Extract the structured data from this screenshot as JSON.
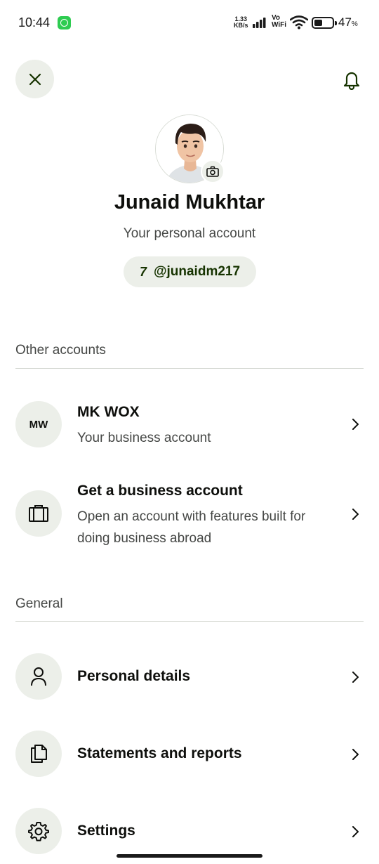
{
  "status_bar": {
    "time": "10:44",
    "net_speed_value": "1.33",
    "net_speed_unit": "KB/s",
    "vo_label": "Vo",
    "wifi_label": "WiFi",
    "battery_percent": "47",
    "battery_level": 0.47,
    "percent_sign": "%"
  },
  "header": {
    "close_icon": "close-icon",
    "notification_icon": "bell-icon"
  },
  "profile": {
    "name": "Junaid Mukhtar",
    "account_type": "Your personal account",
    "brand_mark": "7",
    "handle": "@junaidm217",
    "camera_icon": "camera-icon"
  },
  "other_accounts": {
    "title": "Other accounts",
    "items": [
      {
        "initials": "MW",
        "name": "MK WOX",
        "description": "Your business account"
      },
      {
        "icon": "briefcase-icon",
        "name": "Get a business account",
        "description": "Open an account with features built for doing business abroad"
      }
    ]
  },
  "general": {
    "title": "General",
    "items": [
      {
        "icon": "person-icon",
        "label": "Personal details"
      },
      {
        "icon": "document-icon",
        "label": "Statements and reports"
      },
      {
        "icon": "gear-icon",
        "label": "Settings"
      }
    ]
  },
  "colors": {
    "accent_dark_green": "#163300",
    "icon_circle_bg": "#ecefe9",
    "text_primary": "#0e0f0c",
    "text_secondary": "#454745",
    "divider": "#d5d8d2"
  }
}
